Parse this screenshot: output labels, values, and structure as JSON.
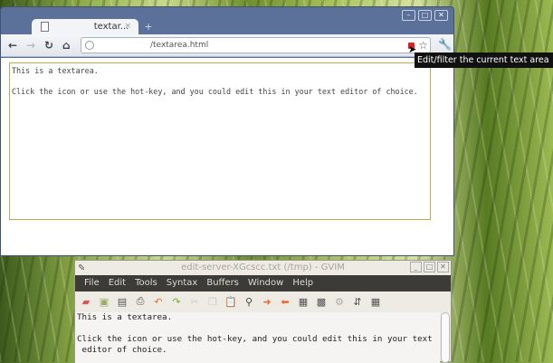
{
  "browser": {
    "tab_title": "textar...",
    "url": "/textarea.html",
    "textarea_text": "This is a textarea.\n\nClick the icon or use the hot-key, and you could edit this in your text editor of choice.",
    "tooltip": "Edit/filter the current text area"
  },
  "gvim": {
    "title": "edit-server-XGcscc.txt (/tmp) - GVIM",
    "menu": [
      "File",
      "Edit",
      "Tools",
      "Syntax",
      "Buffers",
      "Window",
      "Help"
    ],
    "lines": [
      "This is a textarea.",
      "",
      "Click the icon or use the hot-key, and you could edit this in your text",
      " editor of choice."
    ]
  }
}
